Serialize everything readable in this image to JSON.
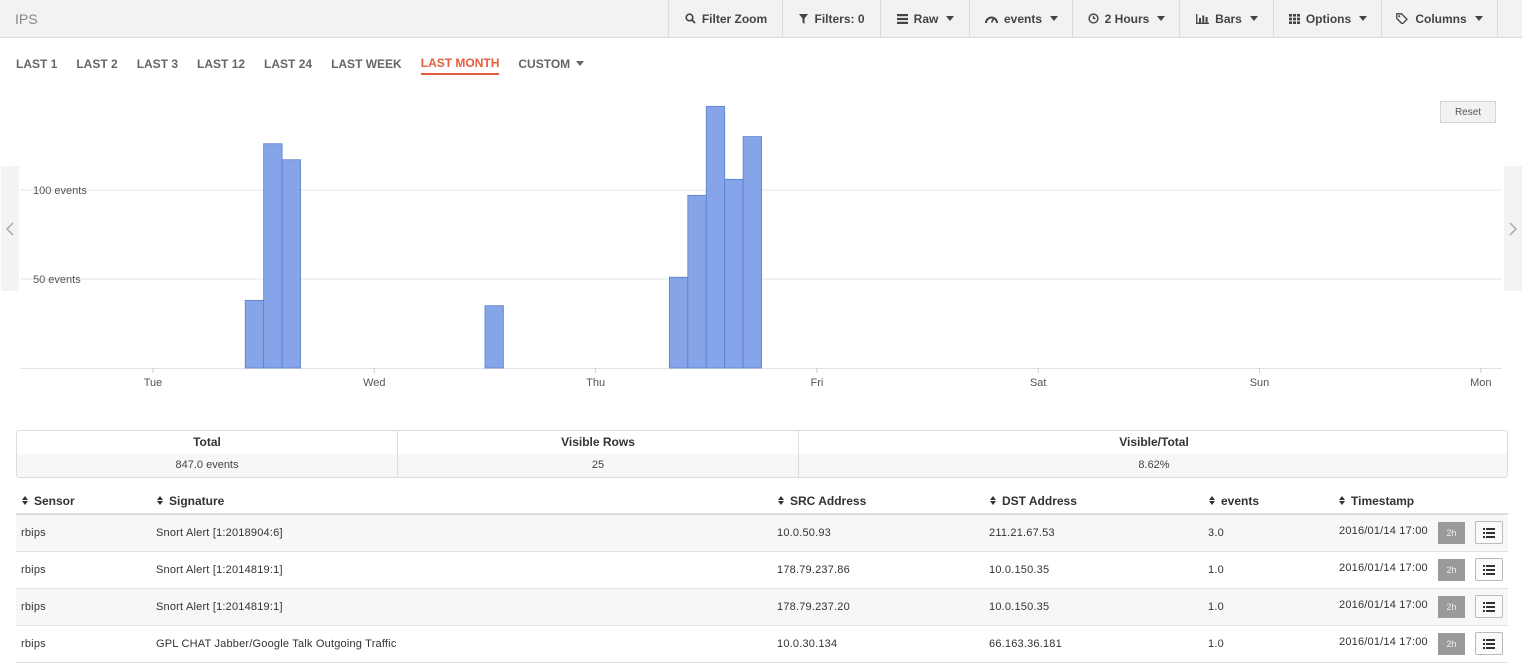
{
  "app": {
    "title": "IPS"
  },
  "toolbar": {
    "filter_zoom": "Filter Zoom",
    "filters": "Filters: 0",
    "raw": "Raw",
    "events": "events",
    "hours": "2 Hours",
    "bars": "Bars",
    "options": "Options",
    "columns": "Columns"
  },
  "range_tabs": {
    "items": [
      "LAST 1",
      "LAST 2",
      "LAST 3",
      "LAST 12",
      "LAST 24",
      "LAST WEEK",
      "LAST MONTH",
      "CUSTOM"
    ],
    "active": "LAST MONTH"
  },
  "chart_controls": {
    "reset": "Reset"
  },
  "chart_data": {
    "type": "bar",
    "ylabel": "",
    "ytick_labels": [
      "50 events",
      "100 events"
    ],
    "y_ticks": [
      50,
      100
    ],
    "ylim": [
      0,
      150
    ],
    "x_ticks": [
      "Tue",
      "Wed",
      "Thu",
      "Fri",
      "Sat",
      "Sun",
      "Mon"
    ],
    "x_range_days": [
      0,
      6
    ],
    "bar_width_hours": 2,
    "series": [
      {
        "color": "#7b9de6",
        "bars": [
          {
            "day": 0,
            "hour": 11,
            "value": 38
          },
          {
            "day": 0,
            "hour": 13,
            "value": 126
          },
          {
            "day": 0,
            "hour": 15,
            "value": 117
          },
          {
            "day": 1,
            "hour": 13,
            "value": 35
          },
          {
            "day": 2,
            "hour": 9,
            "value": 51
          },
          {
            "day": 2,
            "hour": 11,
            "value": 97
          },
          {
            "day": 2,
            "hour": 13,
            "value": 147
          },
          {
            "day": 2,
            "hour": 15,
            "value": 106
          },
          {
            "day": 2,
            "hour": 17,
            "value": 130
          }
        ]
      }
    ],
    "grid": true,
    "legend": "none"
  },
  "summary": {
    "headers": [
      "Total",
      "Visible Rows",
      "Visible/Total"
    ],
    "values": [
      "847.0 events",
      "25",
      "8.62%"
    ]
  },
  "table": {
    "columns": [
      "Sensor",
      "Signature",
      "SRC Address",
      "DST Address",
      "events",
      "Timestamp"
    ],
    "rows": [
      {
        "sensor": "rbips",
        "signature": "Snort Alert [1:2018904:6]",
        "src": "10.0.50.93",
        "dst": "211.21.67.53",
        "events": "3.0",
        "timestamp": "2016/01/14 17:00",
        "chip": "2h"
      },
      {
        "sensor": "rbips",
        "signature": "Snort Alert [1:2014819:1]",
        "src": "178.79.237.86",
        "dst": "10.0.150.35",
        "events": "1.0",
        "timestamp": "2016/01/14 17:00",
        "chip": "2h"
      },
      {
        "sensor": "rbips",
        "signature": "Snort Alert [1:2014819:1]",
        "src": "178.79.237.20",
        "dst": "10.0.150.35",
        "events": "1.0",
        "timestamp": "2016/01/14 17:00",
        "chip": "2h"
      },
      {
        "sensor": "rbips",
        "signature": "GPL CHAT Jabber/Google Talk Outgoing Traffic",
        "src": "10.0.30.134",
        "dst": "66.163.36.181",
        "events": "1.0",
        "timestamp": "2016/01/14 17:00",
        "chip": "2h"
      }
    ]
  },
  "icons": {
    "filter_zoom": "search-icon",
    "filters": "filter-icon",
    "raw": "raw-icon",
    "events": "dashboard-icon",
    "hours": "clock-icon",
    "bars": "bar-chart-icon",
    "options": "grid-icon",
    "columns": "tags-icon",
    "row_action": "list-icon"
  }
}
